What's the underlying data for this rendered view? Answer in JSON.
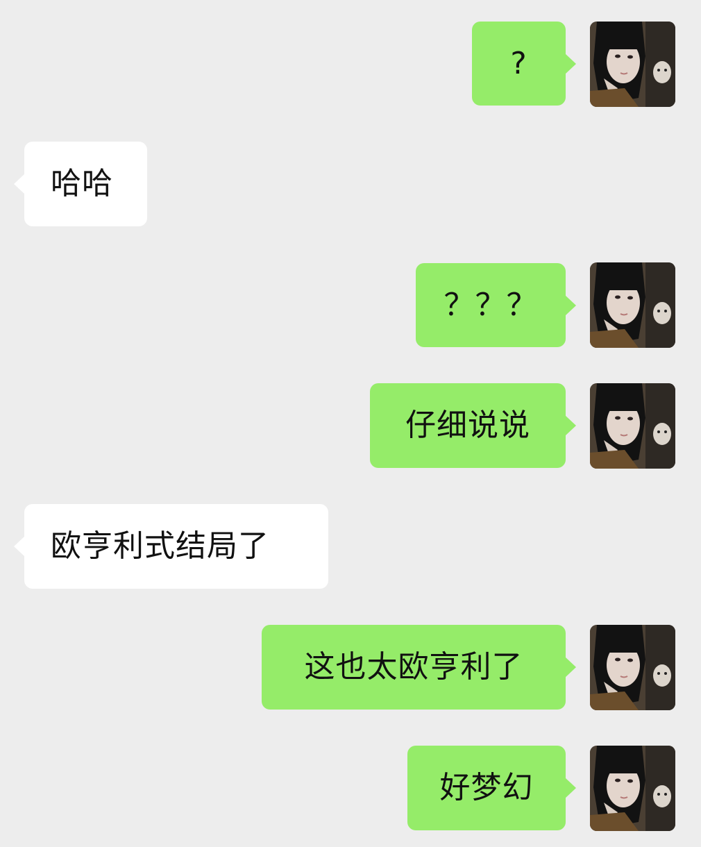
{
  "chat": {
    "messages": [
      {
        "direction": "sent",
        "text": "?",
        "avatar_icon": "user-avatar-photo"
      },
      {
        "direction": "received",
        "text": "哈哈"
      },
      {
        "direction": "sent",
        "text": "？？？",
        "avatar_icon": "user-avatar-photo"
      },
      {
        "direction": "sent",
        "text": "仔细说说",
        "avatar_icon": "user-avatar-photo"
      },
      {
        "direction": "received",
        "text": "欧亨利式结局了"
      },
      {
        "direction": "sent",
        "text": "这也太欧亨利了",
        "avatar_icon": "user-avatar-photo"
      },
      {
        "direction": "sent",
        "text": "好梦幻",
        "avatar_icon": "user-avatar-photo"
      }
    ]
  },
  "colors": {
    "background": "#ededed",
    "sent_bubble": "#95ec69",
    "received_bubble": "#ffffff",
    "text": "#111111"
  }
}
